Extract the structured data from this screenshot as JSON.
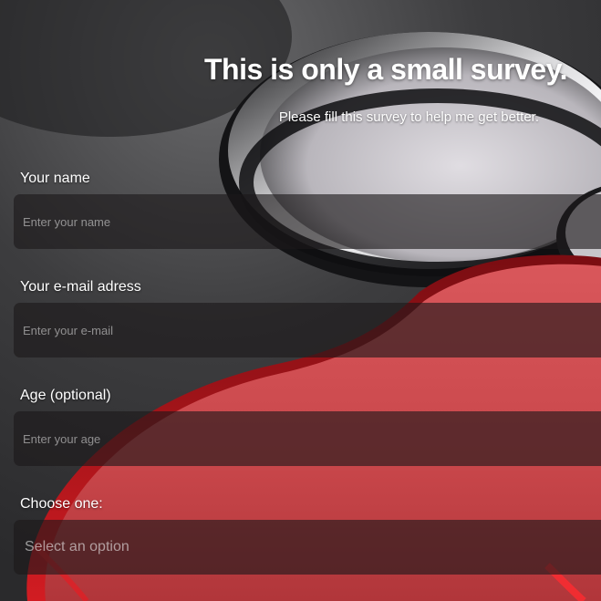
{
  "survey": {
    "title": "This is only a small survey.",
    "subtitle": "Please fill this survey to help me get better."
  },
  "fields": {
    "name": {
      "label": "Your name",
      "placeholder": "Enter your name"
    },
    "email": {
      "label": "Your e-mail adress",
      "placeholder": "Enter your e-mail"
    },
    "age": {
      "label": "Age (optional)",
      "placeholder": "Enter your age"
    },
    "choice": {
      "label": "Choose one:",
      "selected": "Select an option"
    }
  },
  "colors": {
    "text": "#ffffff",
    "field_bg": "#1c181a",
    "accent_red": "#c8464a"
  }
}
